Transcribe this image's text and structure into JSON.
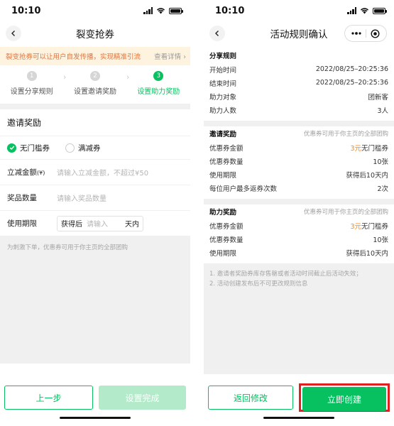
{
  "status": {
    "time": "10:10"
  },
  "colors": {
    "accent": "#07c160",
    "warning_text": "#e0743f",
    "highlight_orange": "#f08a24",
    "annotation_red": "#e02020"
  },
  "icons": {
    "back": "chevron-left-icon",
    "more": "more-dots-icon",
    "close": "target-close-icon",
    "check": "check-icon"
  },
  "p1": {
    "nav_title": "裂变抢券",
    "notice": {
      "text": "裂变抢券可以让用户自发传播，实现精准引流",
      "more": "查看详情"
    },
    "steps": [
      {
        "num": "1",
        "label": "设置分享规则"
      },
      {
        "num": "2",
        "label": "设置邀请奖励"
      },
      {
        "num": "3",
        "label": "设置助力奖励"
      }
    ],
    "section_title": "邀请奖励",
    "coupon_types": [
      "无门槛券",
      "满减券"
    ],
    "form": {
      "amount_label": "立减金额",
      "amount_unit": "(¥)",
      "amount_placeholder": "请输入立减金额，不超过¥50",
      "quantity_label": "奖品数量",
      "quantity_placeholder": "请输入奖品数量",
      "period_label": "使用期限",
      "period_prefix": "获得后",
      "period_placeholder": "请输入",
      "period_suffix": "天内"
    },
    "hint": "为刺激下单，优惠券可用于你主页的全部团购",
    "btn_prev": "上一步",
    "btn_done": "设置完成"
  },
  "p2": {
    "nav_title": "活动规则确认",
    "share": {
      "title": "分享规则",
      "rows": [
        {
          "label": "开始时间",
          "value": "2022/08/25–20:25:36"
        },
        {
          "label": "结束时间",
          "value": "2022/08/25–20:25:36"
        },
        {
          "label": "助力对象",
          "value": "团新客"
        },
        {
          "label": "助力人数",
          "value": "3人"
        }
      ]
    },
    "invite": {
      "title": "邀请奖励",
      "note": "优惠券可用于你主页的全部团购",
      "amount_label": "优惠券金额",
      "amount_value": "3元",
      "amount_type": "无门槛券",
      "rows": [
        {
          "label": "优惠券数量",
          "value": "10张"
        },
        {
          "label": "使用期限",
          "value": "获得后10天内"
        },
        {
          "label": "每位用户最多返券次数",
          "value": "2次"
        }
      ]
    },
    "assist": {
      "title": "助力奖励",
      "note": "优惠券可用于你主页的全部团购",
      "amount_label": "优惠券金额",
      "amount_value": "3元",
      "amount_type": "无门槛券",
      "rows": [
        {
          "label": "优惠券数量",
          "value": "10张"
        },
        {
          "label": "使用期限",
          "value": "获得后10天内"
        }
      ]
    },
    "notes": [
      "1. 邀请者奖励券库存售罄或者活动时间截止后活动失效；",
      "2. 活动创建发布后不可更改规则信息"
    ],
    "btn_back": "返回修改",
    "btn_create": "立即创建"
  }
}
